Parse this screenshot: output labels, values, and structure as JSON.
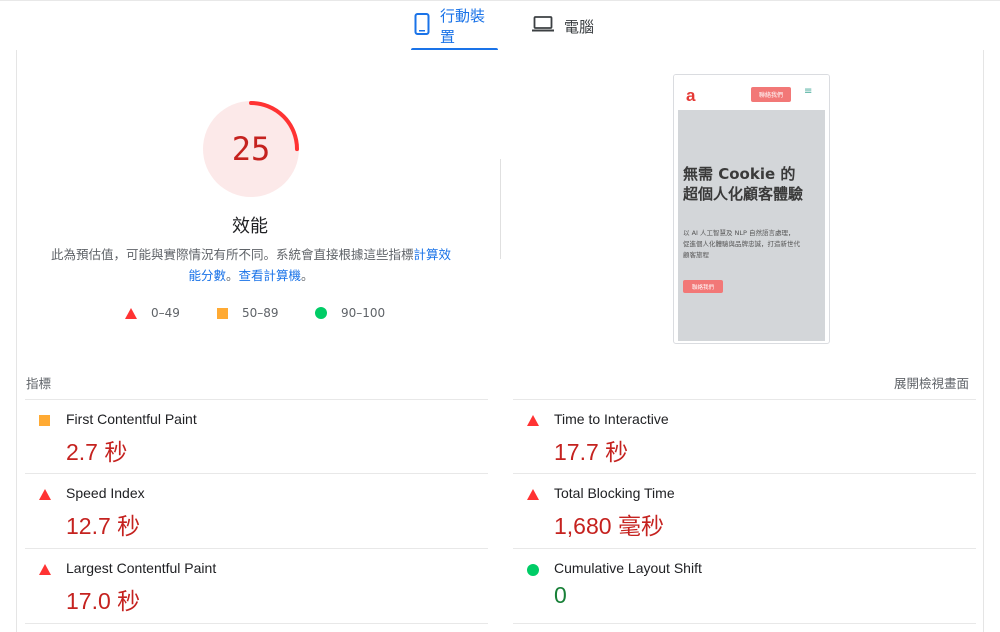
{
  "tabs": {
    "mobile": {
      "label": "行動裝置",
      "icon": "smartphone-icon",
      "active": true
    },
    "desktop": {
      "label": "電腦",
      "icon": "laptop-icon",
      "active": false
    }
  },
  "performance": {
    "score": "25",
    "score_fraction": 0.25,
    "title": "效能",
    "desc_prefix": "此為預估值，可能與實際情況有所不同。系統會直接根據這些指標",
    "desc_link_calc": "計算效能分數",
    "desc_mid": "。",
    "desc_link_calculator": "查看計算機",
    "desc_suffix": "。",
    "colors": {
      "fail": "#ff3333",
      "fail_bg": "#fce9e9",
      "fail_text": "#c5221f",
      "average": "#ffaa33",
      "pass": "#00cc66"
    }
  },
  "legend": [
    {
      "icon": "triangle-icon",
      "label": "0–49"
    },
    {
      "icon": "square-icon",
      "label": "50–89"
    },
    {
      "icon": "circle-icon",
      "label": "90–100"
    }
  ],
  "screenshot": {
    "logo": "a",
    "header_cta": "聯絡我們",
    "menu_icon": "≡",
    "hero_title": "無需 Cookie 的超個人化顧客體驗",
    "hero_body": "以 AI 人工智慧及 NLP 自然語言處理，促進個人化體驗與品牌忠誠，打造新世代顧客旅程",
    "hero_button": "聯絡我們"
  },
  "metrics": {
    "section_label": "指標",
    "expand_label": "展開檢視畫面",
    "items": [
      {
        "name": "First Contentful Paint",
        "value": "2.7 秒",
        "status": "average"
      },
      {
        "name": "Time to Interactive",
        "value": "17.7 秒",
        "status": "fail"
      },
      {
        "name": "Speed Index",
        "value": "12.7 秒",
        "status": "fail"
      },
      {
        "name": "Total Blocking Time",
        "value": "1,680 毫秒",
        "status": "fail"
      },
      {
        "name": "Largest Contentful Paint",
        "value": "17.0 秒",
        "status": "fail"
      },
      {
        "name": "Cumulative Layout Shift",
        "value": "0",
        "status": "pass"
      }
    ]
  }
}
